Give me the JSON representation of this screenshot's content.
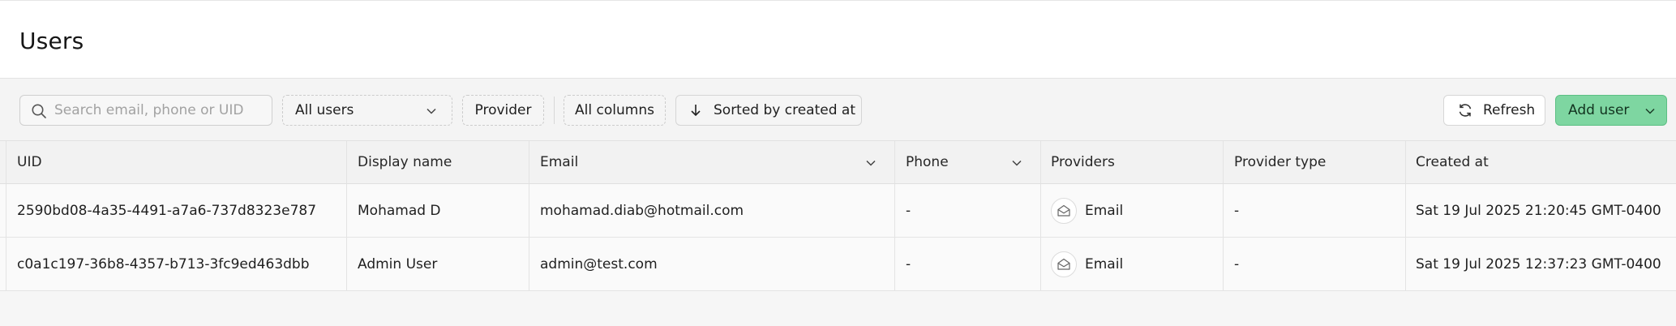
{
  "header": {
    "title": "Users"
  },
  "toolbar": {
    "search_placeholder": "Search email, phone or UID",
    "users_filter": "All users",
    "provider_label": "Provider",
    "columns_label": "All columns",
    "sort_label": "Sorted by created at",
    "refresh_label": "Refresh",
    "add_user_label": "Add user"
  },
  "table": {
    "columns": [
      "UID",
      "Display name",
      "Email",
      "Phone",
      "Providers",
      "Provider type",
      "Created at"
    ],
    "rows": [
      {
        "uid": "2590bd08-4a35-4491-a7a6-737d8323e787",
        "display_name": "Mohamad D",
        "email": "mohamad.diab@hotmail.com",
        "phone": "-",
        "provider": "Email",
        "provider_type": "-",
        "created_at": "Sat 19 Jul 2025 21:20:45 GMT-0400"
      },
      {
        "uid": "c0a1c197-36b8-4357-b713-3fc9ed463dbb",
        "display_name": "Admin User",
        "email": "admin@test.com",
        "phone": "-",
        "provider": "Email",
        "provider_type": "-",
        "created_at": "Sat 19 Jul 2025 12:37:23 GMT-0400"
      }
    ]
  },
  "colors": {
    "accent": "#7ed6a1",
    "accent_border": "#5cbf83"
  }
}
